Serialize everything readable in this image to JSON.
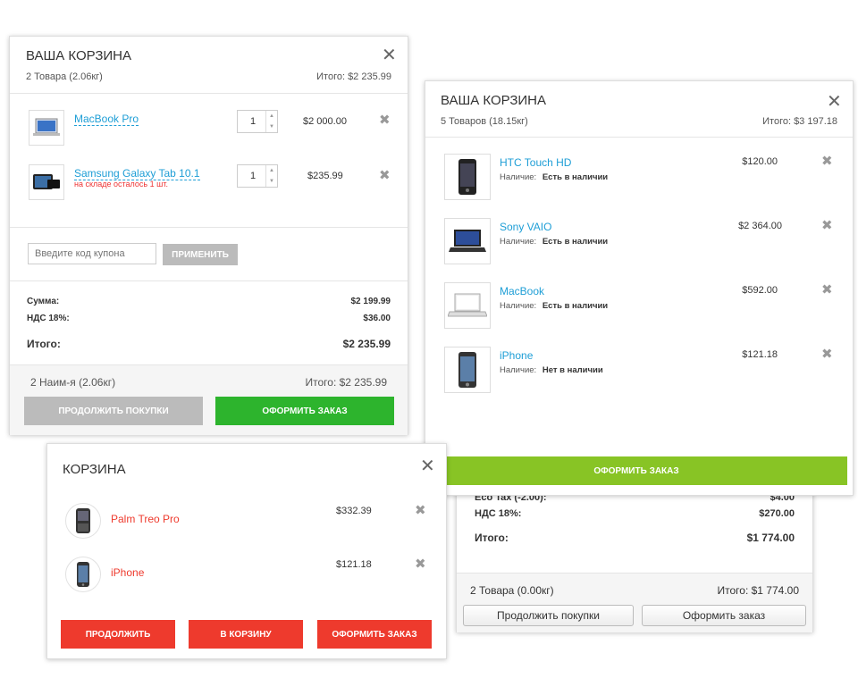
{
  "cart1": {
    "title": "ВАША КОРЗИНА",
    "summary": "2 Товара (2.06кг)",
    "total": "Итого: $2 235.99",
    "items": [
      {
        "name": "MacBook Pro",
        "qty": "1",
        "price": "$2 000.00",
        "note": ""
      },
      {
        "name": "Samsung Galaxy Tab 10.1",
        "qty": "1",
        "price": "$235.99",
        "note": "на складе осталось 1 шт."
      }
    ],
    "coupon_placeholder": "Введите код купона",
    "apply_label": "ПРИМЕНИТЬ",
    "totals": [
      {
        "label": "Сумма:",
        "value": "$2 199.99"
      },
      {
        "label": "НДС 18%:",
        "value": "$36.00"
      }
    ],
    "grand_label": "Итого:",
    "grand_value": "$2 235.99",
    "footer_left": "2 Наим-я (2.06кг)",
    "footer_right": "Итого: $2 235.99",
    "continue_label": "ПРОДОЛЖИТЬ ПОКУПКИ",
    "checkout_label": "ОФОРМИТЬ ЗАКАЗ"
  },
  "cart2": {
    "title": "ВАША КОРЗИНА",
    "summary": "5 Товаров (18.15кг)",
    "total": "Итого: $3 197.18",
    "stock_label": "Наличие:",
    "items": [
      {
        "name": "HTC Touch HD",
        "stock": "Есть в наличии",
        "price": "$120.00"
      },
      {
        "name": "Sony VAIO",
        "stock": "Есть в наличии",
        "price": "$2 364.00"
      },
      {
        "name": "MacBook",
        "stock": "Есть в наличии",
        "price": "$592.00"
      },
      {
        "name": "iPhone",
        "stock": "Нет в наличии",
        "price": "$121.18"
      }
    ],
    "checkout_label": "ОФОРМИТЬ ЗАКАЗ"
  },
  "cart3": {
    "title": "КОРЗИНА",
    "items": [
      {
        "name": "Palm Treo Pro",
        "price": "$332.39"
      },
      {
        "name": "iPhone",
        "price": "$121.18"
      }
    ],
    "continue_label": "ПРОДОЛЖИТЬ",
    "to_cart_label": "В КОРЗИНУ",
    "checkout_label": "ОФОРМИТЬ ЗАКАЗ"
  },
  "cart4": {
    "partial_row": "Eco Tax (-2.00):",
    "partial_value": "$4.00",
    "vat_label": "НДС 18%:",
    "vat_value": "$270.00",
    "grand_label": "Итого:",
    "grand_value": "$1 774.00",
    "footer_left": "2 Товара  (0.00кг)",
    "footer_right": "Итого: $1 774.00",
    "continue_label": "Продолжить покупки",
    "checkout_label": "Оформить заказ"
  },
  "icons": {
    "close": "close-icon",
    "remove": "remove-icon"
  },
  "colors": {
    "link": "#1e9ed6",
    "green": "#2db42d",
    "lime": "#88c425",
    "red": "#ee3a2d",
    "grey_btn": "#bbbbbb"
  }
}
